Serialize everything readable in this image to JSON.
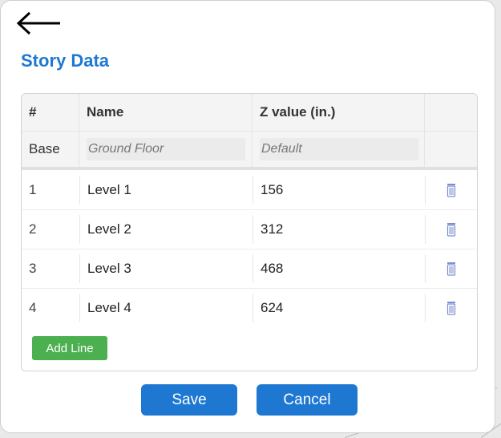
{
  "dialog": {
    "title": "Story Data"
  },
  "table": {
    "headers": [
      "#",
      "Name",
      "Z value (in.)"
    ],
    "base_row": {
      "label": "Base",
      "name_placeholder": "Ground Floor",
      "z_placeholder": "Default"
    },
    "rows": [
      {
        "num": "1",
        "name": "Level 1",
        "z": "156"
      },
      {
        "num": "2",
        "name": "Level 2",
        "z": "312"
      },
      {
        "num": "3",
        "name": "Level 3",
        "z": "468"
      },
      {
        "num": "4",
        "name": "Level 4",
        "z": "624"
      }
    ],
    "add_line_label": "Add Line"
  },
  "footer": {
    "save_label": "Save",
    "cancel_label": "Cancel"
  },
  "colors": {
    "title": "#1e78d2",
    "primary_button": "#1e78d2",
    "add_button": "#4caf50",
    "trash_icon": "#7a8fd0"
  },
  "icons": {
    "back": "back-arrow-icon",
    "delete": "trash-icon"
  }
}
